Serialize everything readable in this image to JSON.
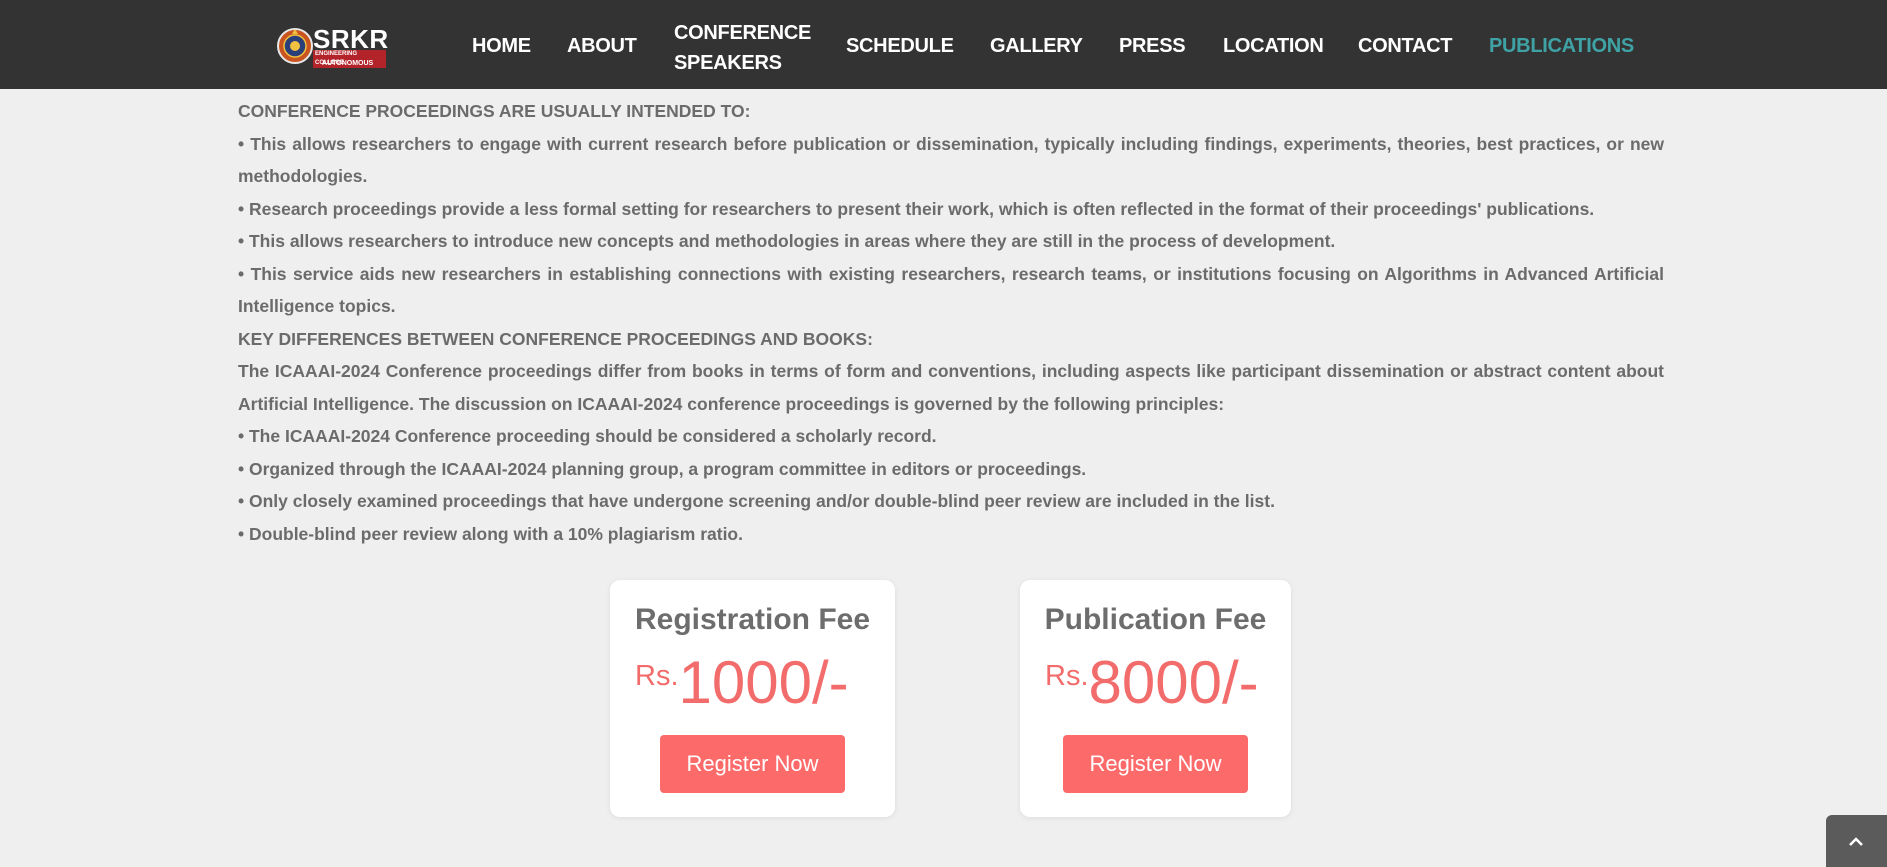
{
  "header": {
    "logo": {
      "name": "SRKR",
      "subtitle": "ENGINEERING COLLEGE",
      "tagline": "AUTONOMOUS"
    },
    "nav": [
      {
        "label": "HOME"
      },
      {
        "label": "ABOUT"
      },
      {
        "label_line1": "CONFERENCE",
        "label_line2": "SPEAKERS"
      },
      {
        "label": "SCHEDULE"
      },
      {
        "label": "GALLERY"
      },
      {
        "label": "PRESS"
      },
      {
        "label": "LOCATION"
      },
      {
        "label": "CONTACT"
      },
      {
        "label": "PUBLICATIONS",
        "active": true
      }
    ],
    "active_color": "#3fa3a6"
  },
  "content": {
    "heading1": "CONFERENCE PROCEEDINGS ARE USUALLY INTENDED TO:",
    "intended_items": [
      "• This allows researchers to engage with current research before publication or dissemination, typically including findings, experiments, theories, best practices, or new methodologies.",
      "• Research proceedings provide a less formal setting for researchers to present their work, which is often reflected in the format of their proceedings' publications.",
      "• This allows researchers to introduce new concepts and methodologies in areas where they are still in the process of development.",
      "• This service aids new researchers in establishing connections with existing researchers, research teams, or institutions focusing on Algorithms in Advanced Artificial Intelligence topics."
    ],
    "heading2": "KEY DIFFERENCES BETWEEN CONFERENCE PROCEEDINGS AND BOOKS:",
    "paragraph": "The ICAAAI-2024 Conference proceedings differ from books in terms of form and conventions, including aspects like participant dissemination or abstract content about Artificial Intelligence. The discussion on ICAAAI-2024 conference proceedings is governed by the following principles:",
    "principles": [
      "• The ICAAAI-2024 Conference proceeding should be considered a scholarly record.",
      "• Organized through the ICAAAI-2024 planning group, a program committee in editors or proceedings.",
      "• Only closely examined proceedings that have undergone screening and/or double-blind peer review are included in the list.",
      "• Double-blind peer review along with a 10% plagiarism ratio."
    ]
  },
  "fees": [
    {
      "title": "Registration Fee",
      "currency": "Rs.",
      "amount": "1000/-",
      "button": "Register Now"
    },
    {
      "title": "Publication Fee",
      "currency": "Rs.",
      "amount": "8000/-",
      "button": "Register Now"
    }
  ],
  "colors": {
    "nav_bg": "#333333",
    "page_bg": "#efefef",
    "text": "#6b6b6b",
    "price": "#f26c6c",
    "button": "#fc6a6a"
  },
  "icons": {
    "scroll_top": "chevron-up-icon"
  }
}
